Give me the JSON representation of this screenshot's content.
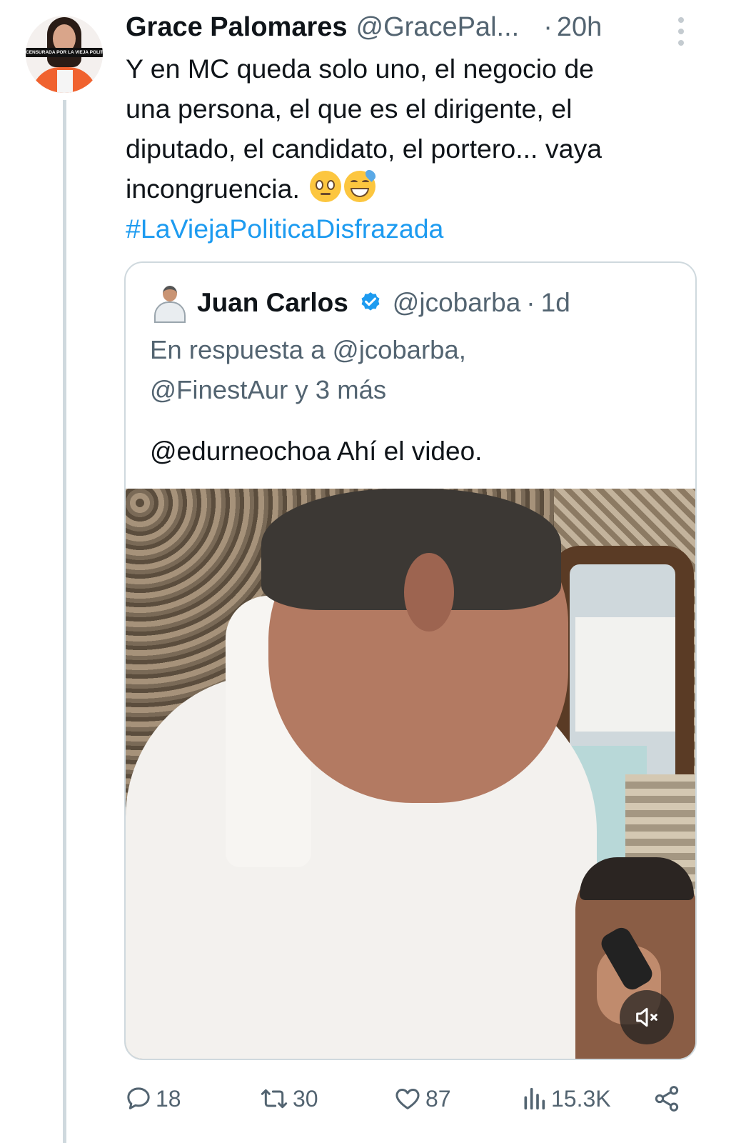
{
  "tweet": {
    "author_name": "Grace Palomares",
    "author_handle": "@GracePal...",
    "separator": "·",
    "time": "20h",
    "avatar_banner": "CENSURADA POR LA VIEJA POLITICA",
    "text_lines": [
      "Y en MC queda solo uno, el negocio de",
      "una persona, el que es el dirigente, el",
      "diputado, el candidato, el portero... vaya",
      "incongruencia."
    ],
    "emojis": [
      "face-with-rolling-eyes",
      "grinning-face-with-sweat"
    ],
    "hashtag": "#LaViejaPoliticaDisfrazada"
  },
  "quote": {
    "author_name": "Juan Carlos",
    "author_handle": "@jcobarba",
    "separator": "·",
    "time": "1d",
    "reply_lines": [
      "En respuesta a @jcobarba,",
      "@FinestAur y 3 más"
    ],
    "text": "@edurneochoa Ahí el video.",
    "video_muted": true
  },
  "actions": {
    "replies": "18",
    "reposts": "30",
    "likes": "87",
    "views": "15.3K"
  },
  "colors": {
    "text": "#0f1419",
    "secondary": "#536471",
    "link": "#1d9bf0",
    "border": "#cfd9de",
    "verified": "#1d9bf0"
  }
}
